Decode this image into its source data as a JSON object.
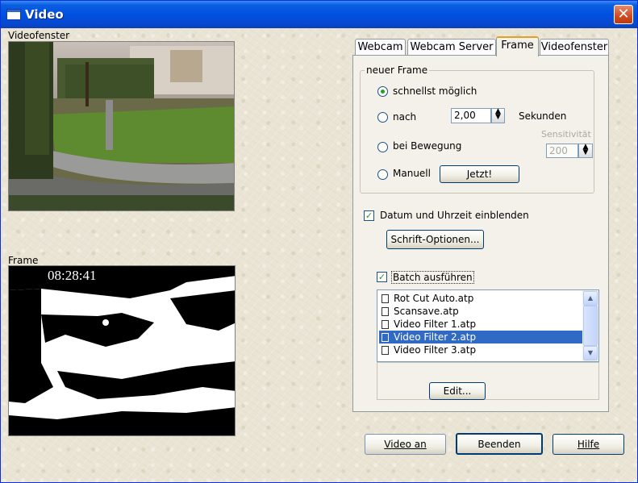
{
  "window": {
    "title": "Video",
    "close_glyph": "✕"
  },
  "left": {
    "video_label": "Videofenster",
    "frame_label": "Frame",
    "frame_timestamp": "08:28:41"
  },
  "tabs": [
    {
      "label": "Webcam"
    },
    {
      "label": "Webcam Server"
    },
    {
      "label": "Frame",
      "active": true
    },
    {
      "label": "Videofenster"
    }
  ],
  "frame_group": {
    "title": "neuer Frame",
    "radio_asap": "schnellst möglich",
    "radio_after": "nach",
    "after_value": "2,00",
    "after_unit": "Sekunden",
    "radio_motion": "bei Bewegung",
    "sensitivity_label": "Sensitivität",
    "sensitivity_value": "200",
    "radio_manual": "Manuell",
    "now_button": "Jetzt!",
    "selected": "schnellst möglich"
  },
  "datetime": {
    "label": "Datum und Uhrzeit einblenden",
    "checked": true
  },
  "font_options_button": "Schrift-Optionen...",
  "batch": {
    "label": "Batch ausführen",
    "checked": true,
    "files": [
      "Rot Cut Auto.atp",
      "Scansave.atp",
      "Video Filter 1.atp",
      "Video Filter 2.atp",
      "Video Filter 3.atp"
    ],
    "selected_index": 3,
    "edit_button": "Edit..."
  },
  "footer": {
    "video_on": "Video an",
    "quit": "Beenden",
    "help": "Hilfe"
  },
  "colors": {
    "selection": "#316ac5",
    "titlebar": "#0a5fe0",
    "close": "#d04a20"
  }
}
